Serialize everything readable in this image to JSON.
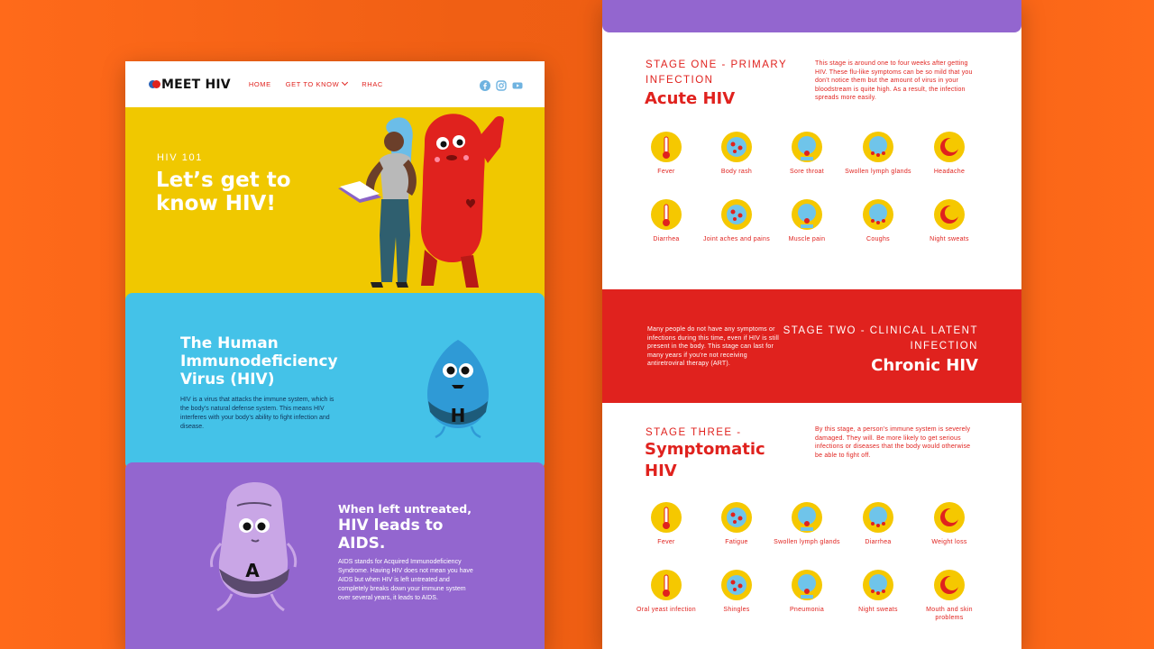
{
  "left": {
    "nav": {
      "logo": "MEET HIV",
      "items": [
        "HOME",
        "GET TO KNOW",
        "RHAC"
      ],
      "social": [
        "facebook-icon",
        "instagram-icon",
        "youtube-icon"
      ]
    },
    "hero": {
      "kicker": "HIV 101",
      "title": "Let’s get to know HIV!"
    },
    "hiv_section": {
      "title": "The Human Immunodeficiency Virus (HIV)",
      "body": "HIV is a virus that attacks the immune system, which is the body’s natural defense system. This means HIV interferes with your body’s ability to fight infection and disease.",
      "mascot_letter": "H"
    },
    "aids_section": {
      "title_small": "When left untreated,",
      "title_big": "HIV leads to AIDS.",
      "body": "AIDS stands for Acquired Immunodeficiency Syndrome. Having HIV does not mean you have AIDS but when HIV is left untreated and completely breaks down your immune system over several years, it leads to AIDS.",
      "mascot_letter": "A"
    }
  },
  "right": {
    "stage1": {
      "label": "STAGE ONE - PRIMARY INFECTION",
      "title": "Acute HIV",
      "desc": "This stage is around one to four weeks after getting HIV. These flu-like symptoms can be so mild that you don't notice them but the amount of virus in your bloodstream is quite high. As a result, the infection spreads more easily.",
      "symptoms": [
        "Fever",
        "Body rash",
        "Sore throat",
        "Swollen lymph glands",
        "Headache",
        "Diarrhea",
        "Joint aches and pains",
        "Muscle pain",
        "Coughs",
        "Night sweats"
      ]
    },
    "stage2": {
      "label": "STAGE TWO - CLINICAL LATENT INFECTION",
      "title": "Chronic HIV",
      "desc": "Many people do not have any symptoms or infections during this time, even if HIV is still present in the body. This stage can last for many years if you're not receiving antiretroviral therapy (ART)."
    },
    "stage3": {
      "label": "STAGE THREE -",
      "title": "Symptomatic HIV",
      "desc": "By this stage, a person's immune system is severely damaged. They will. Be more likely to get serious infections or diseases that the body would otherwise be able to fight off.",
      "symptoms": [
        "Fever",
        "Fatigue",
        "Swollen lymph glands",
        "Diarrhea",
        "Weight loss",
        "Oral yeast infection",
        "Shingles",
        "Pneumonia",
        "Night sweats",
        "Mouth and skin problems"
      ]
    }
  },
  "colors": {
    "background": "#ff6a1a",
    "yellow": "#f0c800",
    "blue": "#44c2e8",
    "purple": "#9366cf",
    "red": "#e0221e"
  }
}
